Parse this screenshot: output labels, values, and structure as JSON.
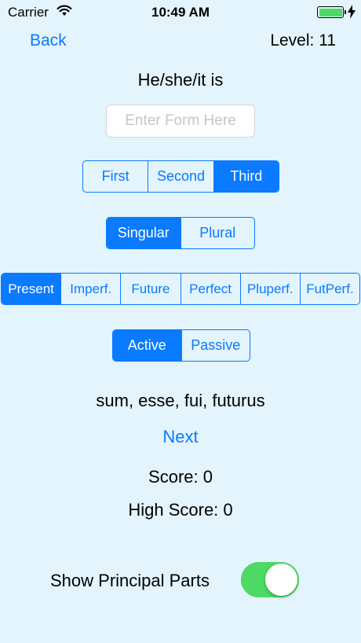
{
  "status_bar": {
    "carrier": "Carrier",
    "time": "10:49 AM",
    "icons": {
      "wifi": "wifi-icon",
      "battery": "battery-icon",
      "charging": "charging-bolt-icon"
    },
    "battery_color": "#4cd964"
  },
  "nav": {
    "back_label": "Back",
    "level_label": "Level: 11"
  },
  "prompt": "He/she/it is",
  "form_input": {
    "placeholder": "Enter Form Here",
    "value": ""
  },
  "person": {
    "options": [
      "First",
      "Second",
      "Third"
    ],
    "selected": "Third"
  },
  "number": {
    "options": [
      "Singular",
      "Plural"
    ],
    "selected": "Singular"
  },
  "tense": {
    "options": [
      "Present",
      "Imperf.",
      "Future",
      "Perfect",
      "Pluperf.",
      "FutPerf."
    ],
    "selected": "Present"
  },
  "voice": {
    "options": [
      "Active",
      "Passive"
    ],
    "selected": "Active"
  },
  "principal_parts": "sum, esse, fui, futurus",
  "next_label": "Next",
  "score_label": "Score: 0",
  "high_score_label": "High Score: 0",
  "toggle": {
    "label": "Show Principal Parts",
    "on": true
  },
  "colors": {
    "accent": "#0a7afe",
    "background": "#e3f4fd",
    "toggle_on": "#4cd964"
  }
}
